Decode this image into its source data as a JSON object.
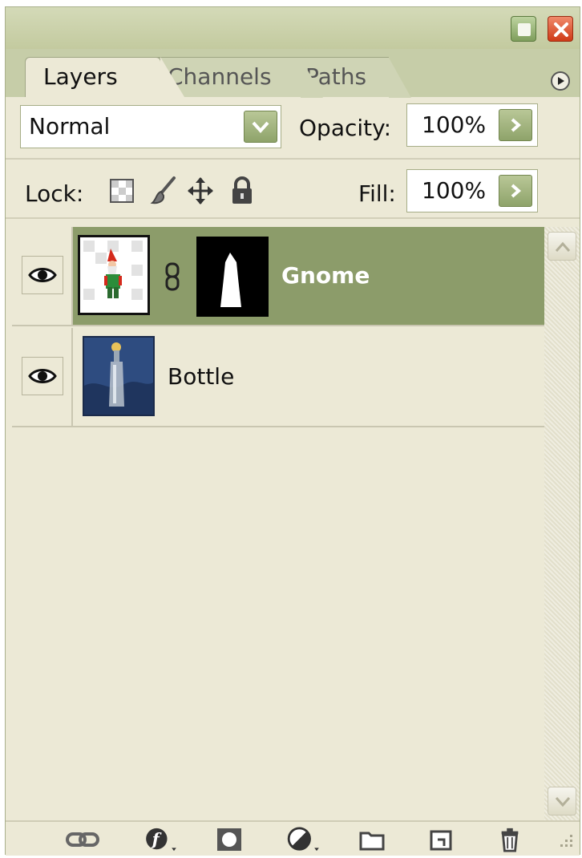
{
  "tabs": [
    {
      "label": "Layers",
      "active": true
    },
    {
      "label": "Channels",
      "active": false
    },
    {
      "label": "Paths",
      "active": false
    }
  ],
  "blend_mode": {
    "selected": "Normal"
  },
  "opacity": {
    "label": "Opacity:",
    "value": "100%"
  },
  "lock": {
    "label": "Lock:",
    "icons": [
      "lock-transparent-pixels-icon",
      "lock-image-pixels-icon",
      "lock-position-icon",
      "lock-all-icon"
    ]
  },
  "fill": {
    "label": "Fill:",
    "value": "100%"
  },
  "layers": [
    {
      "name": "Gnome",
      "visible": true,
      "selected": true,
      "has_mask": true,
      "linked_mask": true
    },
    {
      "name": "Bottle",
      "visible": true,
      "selected": false,
      "has_mask": false
    }
  ],
  "bottom_toolbar": {
    "icons": [
      "link-layers-icon",
      "layer-style-icon",
      "add-mask-icon",
      "adjustment-layer-icon",
      "new-group-icon",
      "new-layer-icon",
      "delete-layer-icon"
    ]
  },
  "colors": {
    "accent": "#8c9c6a",
    "panel_bg": "#ece9d6",
    "frame_bg": "#c6cda8",
    "close_button": "#d9472a",
    "selected_text": "#ffffff"
  }
}
